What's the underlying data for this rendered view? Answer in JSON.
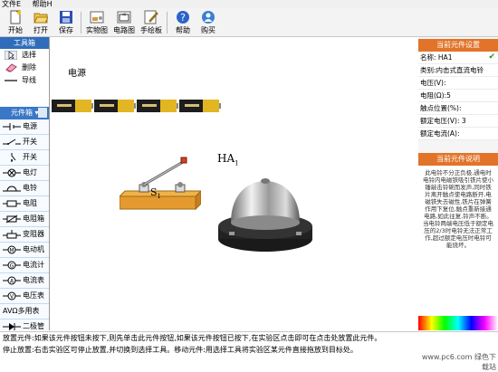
{
  "menu": {
    "file": "文件E",
    "help": "帮助H"
  },
  "toolbar": {
    "buttons": [
      {
        "label": "开始",
        "icon": "new-file-icon"
      },
      {
        "label": "打开",
        "icon": "open-folder-icon"
      },
      {
        "label": "保存",
        "icon": "save-icon"
      },
      {
        "label": "实物图",
        "icon": "physical-view-icon"
      },
      {
        "label": "电路图",
        "icon": "circuit-diagram-icon"
      },
      {
        "label": "手绘板",
        "icon": "drawing-board-icon"
      },
      {
        "label": "帮助",
        "icon": "help-icon"
      },
      {
        "label": "购买",
        "icon": "buy-icon"
      }
    ]
  },
  "tools": {
    "title": "工具箱",
    "items": [
      {
        "label": "选择",
        "icon": "pointer-icon"
      },
      {
        "label": "删除",
        "icon": "eraser-icon"
      },
      {
        "label": "导线",
        "icon": "wire-icon"
      }
    ]
  },
  "components": {
    "title": "元件箱",
    "items": [
      {
        "label": "电源",
        "icon": "battery-symbol-icon"
      },
      {
        "label": "开关",
        "icon": "switch-symbol-icon"
      },
      {
        "label": "开关",
        "icon": "switch-symbol-2-icon"
      },
      {
        "label": "电灯",
        "icon": "lamp-symbol-icon"
      },
      {
        "label": "电铃",
        "icon": "bell-symbol-icon"
      },
      {
        "label": "电阻",
        "icon": "resistor-symbol-icon"
      },
      {
        "label": "电阻箱",
        "icon": "resistor-box-symbol-icon"
      },
      {
        "label": "变阻器",
        "icon": "rheostat-symbol-icon"
      },
      {
        "label": "电动机",
        "icon": "motor-symbol-icon"
      },
      {
        "label": "电流计",
        "icon": "galvanometer-symbol-icon"
      },
      {
        "label": "电流表",
        "icon": "ammeter-symbol-icon"
      },
      {
        "label": "电压表",
        "icon": "voltmeter-symbol-icon"
      },
      {
        "label": "多用表",
        "icon": "multimeter-symbol-icon",
        "prefix": "AVΩ"
      },
      {
        "label": "二极管",
        "icon": "diode-symbol-icon"
      }
    ]
  },
  "canvas": {
    "power_label": "电源",
    "switch_label": "S",
    "switch_sub": "1",
    "bell_label": "HA",
    "bell_sub": "1"
  },
  "props": {
    "title": "当前元件设置",
    "name_label": "名称:",
    "name_value": "HA1",
    "type_label": "类别:",
    "type_value": "内击式直流电铃",
    "voltage_label": "电压(V):",
    "resistance_label": "电阻(Ω):",
    "resistance_value": "5",
    "contact_label": "触点位置(%):",
    "rated_voltage_label": "额定电压(V):",
    "rated_voltage_value": "3",
    "rated_current_label": "额定电流(A):"
  },
  "description": {
    "title": "当前元件说明",
    "text": "此电铃不分正负极,通电时电铃内电磁铁吸引铁片使小锤敲击铃碗而发声,同时铁片离开触点使电路断开,电磁铁失去磁性,铁片在弹簧作用下复位,触点重新接通电路,如此往复,铃声不断。当电铃两端电压低于额定电压的2/3时电铃无法正常工作,超过额定电压时电铃可能烧坏。"
  },
  "status": {
    "line1": "放置元件:如果该元件按钮未按下,则先单击此元件按钮,如果该元件按钮已按下,在实验区点击即可在点击处放置此元件。",
    "line2": "停止放置:右击实验区可停止放置,并切换到选择工具。移动元件:用选择工具将实验区某元件直接拖放到目标处。"
  },
  "watermark": "www.pc6.com 绿色下载站"
}
